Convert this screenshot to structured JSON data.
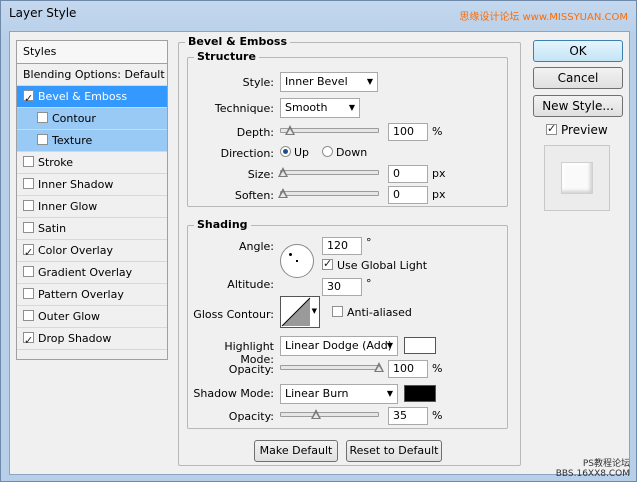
{
  "window": {
    "title": "Layer Style",
    "watermark": "思缘设计论坛  www.MISSYUAN.COM"
  },
  "styles_list": {
    "header": "Styles",
    "items": [
      {
        "label": "Blending Options: Default",
        "checkbox": false,
        "checked": false,
        "state": "normal"
      },
      {
        "label": "Bevel & Emboss",
        "checkbox": true,
        "checked": true,
        "state": "selected"
      },
      {
        "label": "Contour",
        "checkbox": true,
        "checked": false,
        "state": "sub"
      },
      {
        "label": "Texture",
        "checkbox": true,
        "checked": false,
        "state": "sub"
      },
      {
        "label": "Stroke",
        "checkbox": true,
        "checked": false,
        "state": "normal"
      },
      {
        "label": "Inner Shadow",
        "checkbox": true,
        "checked": false,
        "state": "normal"
      },
      {
        "label": "Inner Glow",
        "checkbox": true,
        "checked": false,
        "state": "normal"
      },
      {
        "label": "Satin",
        "checkbox": true,
        "checked": false,
        "state": "normal"
      },
      {
        "label": "Color Overlay",
        "checkbox": true,
        "checked": true,
        "state": "normal"
      },
      {
        "label": "Gradient Overlay",
        "checkbox": true,
        "checked": false,
        "state": "normal"
      },
      {
        "label": "Pattern Overlay",
        "checkbox": true,
        "checked": false,
        "state": "normal"
      },
      {
        "label": "Outer Glow",
        "checkbox": true,
        "checked": false,
        "state": "normal"
      },
      {
        "label": "Drop Shadow",
        "checkbox": true,
        "checked": true,
        "state": "normal"
      }
    ]
  },
  "buttons": {
    "ok": "OK",
    "cancel": "Cancel",
    "new_style": "New Style...",
    "preview": "Preview"
  },
  "bevel": {
    "title": "Bevel & Emboss",
    "structure": {
      "title": "Structure",
      "style_label": "Style:",
      "style_value": "Inner Bevel",
      "technique_label": "Technique:",
      "technique_value": "Smooth",
      "depth_label": "Depth:",
      "depth_value": "100",
      "depth_unit": "%",
      "direction_label": "Direction:",
      "direction_up": "Up",
      "direction_down": "Down",
      "direction_selected": "Up",
      "size_label": "Size:",
      "size_value": "0",
      "size_unit": "px",
      "soften_label": "Soften:",
      "soften_value": "0",
      "soften_unit": "px"
    },
    "shading": {
      "title": "Shading",
      "angle_label": "Angle:",
      "angle_value": "120",
      "angle_unit": "°",
      "global_light_label": "Use Global Light",
      "global_light_checked": true,
      "altitude_label": "Altitude:",
      "altitude_value": "30",
      "altitude_unit": "°",
      "gloss_label": "Gloss Contour:",
      "anti_aliased_label": "Anti-aliased",
      "anti_aliased_checked": false,
      "highlight_label": "Highlight Mode:",
      "highlight_value": "Linear Dodge (Add)",
      "highlight_color": "#ffffff",
      "hl_opacity_label": "Opacity:",
      "hl_opacity_value": "100",
      "hl_opacity_unit": "%",
      "shadow_label": "Shadow Mode:",
      "shadow_value": "Linear Burn",
      "shadow_color": "#000000",
      "sh_opacity_label": "Opacity:",
      "sh_opacity_value": "35",
      "sh_opacity_unit": "%"
    },
    "make_default": "Make Default",
    "reset_default": "Reset to Default"
  },
  "footer_watermark": "PS教程论坛\nBBS.16XX8.COM"
}
